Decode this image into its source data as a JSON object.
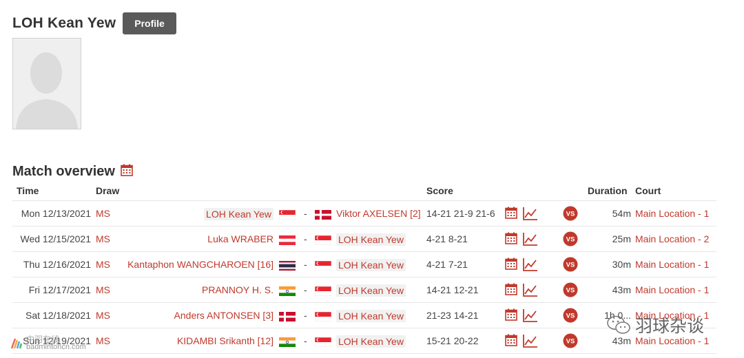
{
  "player": {
    "name": "LOH Kean Yew",
    "profile_label": "Profile"
  },
  "section": {
    "title": "Match overview"
  },
  "table": {
    "headers": {
      "time": "Time",
      "draw": "Draw",
      "score": "Score",
      "duration": "Duration",
      "court": "Court"
    },
    "rows": [
      {
        "time": "Mon 12/13/2021",
        "draw": "MS",
        "player1": "LOH Kean Yew",
        "player1_flag": "SGP",
        "player1_hl": true,
        "dash": "-",
        "player2": "Viktor AXELSEN [2]",
        "player2_flag": "DEN",
        "player2_hl": false,
        "score": "14-21 21-9 21-6",
        "duration": "54m",
        "court": "Main Location - 1"
      },
      {
        "time": "Wed 12/15/2021",
        "draw": "MS",
        "player1": "Luka WRABER",
        "player1_flag": "AUT",
        "player1_hl": false,
        "dash": "-",
        "player2": "LOH Kean Yew",
        "player2_flag": "SGP",
        "player2_hl": true,
        "score": "4-21 8-21",
        "duration": "25m",
        "court": "Main Location - 2"
      },
      {
        "time": "Thu 12/16/2021",
        "draw": "MS",
        "player1": "Kantaphon WANGCHAROEN [16]",
        "player1_flag": "THA",
        "player1_hl": false,
        "dash": "-",
        "player2": "LOH Kean Yew",
        "player2_flag": "SGP",
        "player2_hl": true,
        "score": "4-21 7-21",
        "duration": "30m",
        "court": "Main Location - 1"
      },
      {
        "time": "Fri 12/17/2021",
        "draw": "MS",
        "player1": "PRANNOY H. S.",
        "player1_flag": "IND",
        "player1_hl": false,
        "dash": "-",
        "player2": "LOH Kean Yew",
        "player2_flag": "SGP",
        "player2_hl": true,
        "score": "14-21 12-21",
        "duration": "43m",
        "court": "Main Location - 1"
      },
      {
        "time": "Sat 12/18/2021",
        "draw": "MS",
        "player1": "Anders ANTONSEN [3]",
        "player1_flag": "DEN",
        "player1_hl": false,
        "dash": "-",
        "player2": "LOH Kean Yew",
        "player2_flag": "SGP",
        "player2_hl": true,
        "score": "21-23 14-21",
        "duration": "1h 0...",
        "court": "Main Location - 1"
      },
      {
        "time": "Sun 12/19/2021",
        "draw": "MS",
        "player1": "KIDAMBI Srikanth [12]",
        "player1_flag": "IND",
        "player1_hl": false,
        "dash": "-",
        "player2": "LOH Kean Yew",
        "player2_flag": "SGP",
        "player2_hl": true,
        "score": "15-21 20-22",
        "duration": "43m",
        "court": "Main Location - 1"
      }
    ]
  },
  "watermarks": {
    "right_text": "羽球杂谈",
    "left_top": "中羽在线",
    "left_url": "badmintoncn.com"
  },
  "icons": {
    "calendar": "calendar-icon",
    "chart": "stats-chart-icon",
    "vs": "head-to-head-vs-icon"
  },
  "colors": {
    "accent_red": "#c0392b",
    "profile_button": "#5a5a5a"
  }
}
